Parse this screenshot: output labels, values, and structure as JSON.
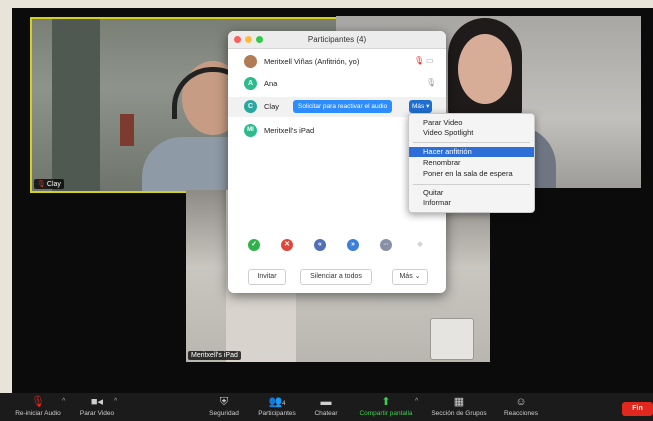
{
  "tiles": {
    "clay_label": "Clay",
    "ipad_label": "Meritxell's iPad"
  },
  "participants_window": {
    "title": "Participantes (4)",
    "rows": [
      {
        "initial": "",
        "name": "Meritxell Viñas (Anfitrión, yo)",
        "avatar_color": "#b07b55"
      },
      {
        "initial": "A",
        "name": "Ana",
        "avatar_color": "#2dbb8e"
      },
      {
        "initial": "C",
        "name": "Clay",
        "avatar_color": "#2aa7a0"
      },
      {
        "initial": "MI",
        "name": "Meritxell's iPad",
        "avatar_color": "#2dbb8e"
      }
    ],
    "reactivate_audio_button": "Solicitar para reactivar el audio",
    "more_row_button": "Más ▾",
    "footer": {
      "invite": "Invitar",
      "mute_all": "Silenciar a todos",
      "more": "Más ⌄"
    },
    "reactions": [
      {
        "name": "yes-reaction",
        "color": "#2db34a",
        "glyph": "✓"
      },
      {
        "name": "no-reaction",
        "color": "#e0473c",
        "glyph": "✕"
      },
      {
        "name": "slower-reaction",
        "color": "#4f6fb6",
        "glyph": "«"
      },
      {
        "name": "faster-reaction",
        "color": "#3b7fd6",
        "glyph": "»"
      },
      {
        "name": "more-reaction",
        "color": "#8a8fa8",
        "glyph": "···"
      },
      {
        "name": "clear-reaction",
        "color": "#d4d4d4",
        "glyph": "◆"
      }
    ]
  },
  "more_menu": {
    "items_group1": [
      "Parar Video",
      "Video Spotlight"
    ],
    "items_group2": [
      "Hacer anfitrión",
      "Renombrar",
      "Poner en la sala de espera"
    ],
    "items_group3": [
      "Quitar",
      "Informar"
    ],
    "highlighted": "Hacer anfitrión"
  },
  "toolbar": {
    "restart_audio": "Re-iniciar Audio",
    "stop_video": "Parar Video",
    "security": "Seguridad",
    "participants": "Participantes",
    "participants_count": "4",
    "chat": "Chatear",
    "share_screen": "Compartir pantalla",
    "breakout_rooms": "Sección de Grupos",
    "reactions": "Reacciones",
    "end": "Fin"
  },
  "colors": {
    "accent_blue": "#2d8cff",
    "menu_highlight": "#2d6fd6",
    "end_red": "#e0281e",
    "share_green": "#3ccf4e",
    "active_speaker_border": "#d4d11c"
  }
}
